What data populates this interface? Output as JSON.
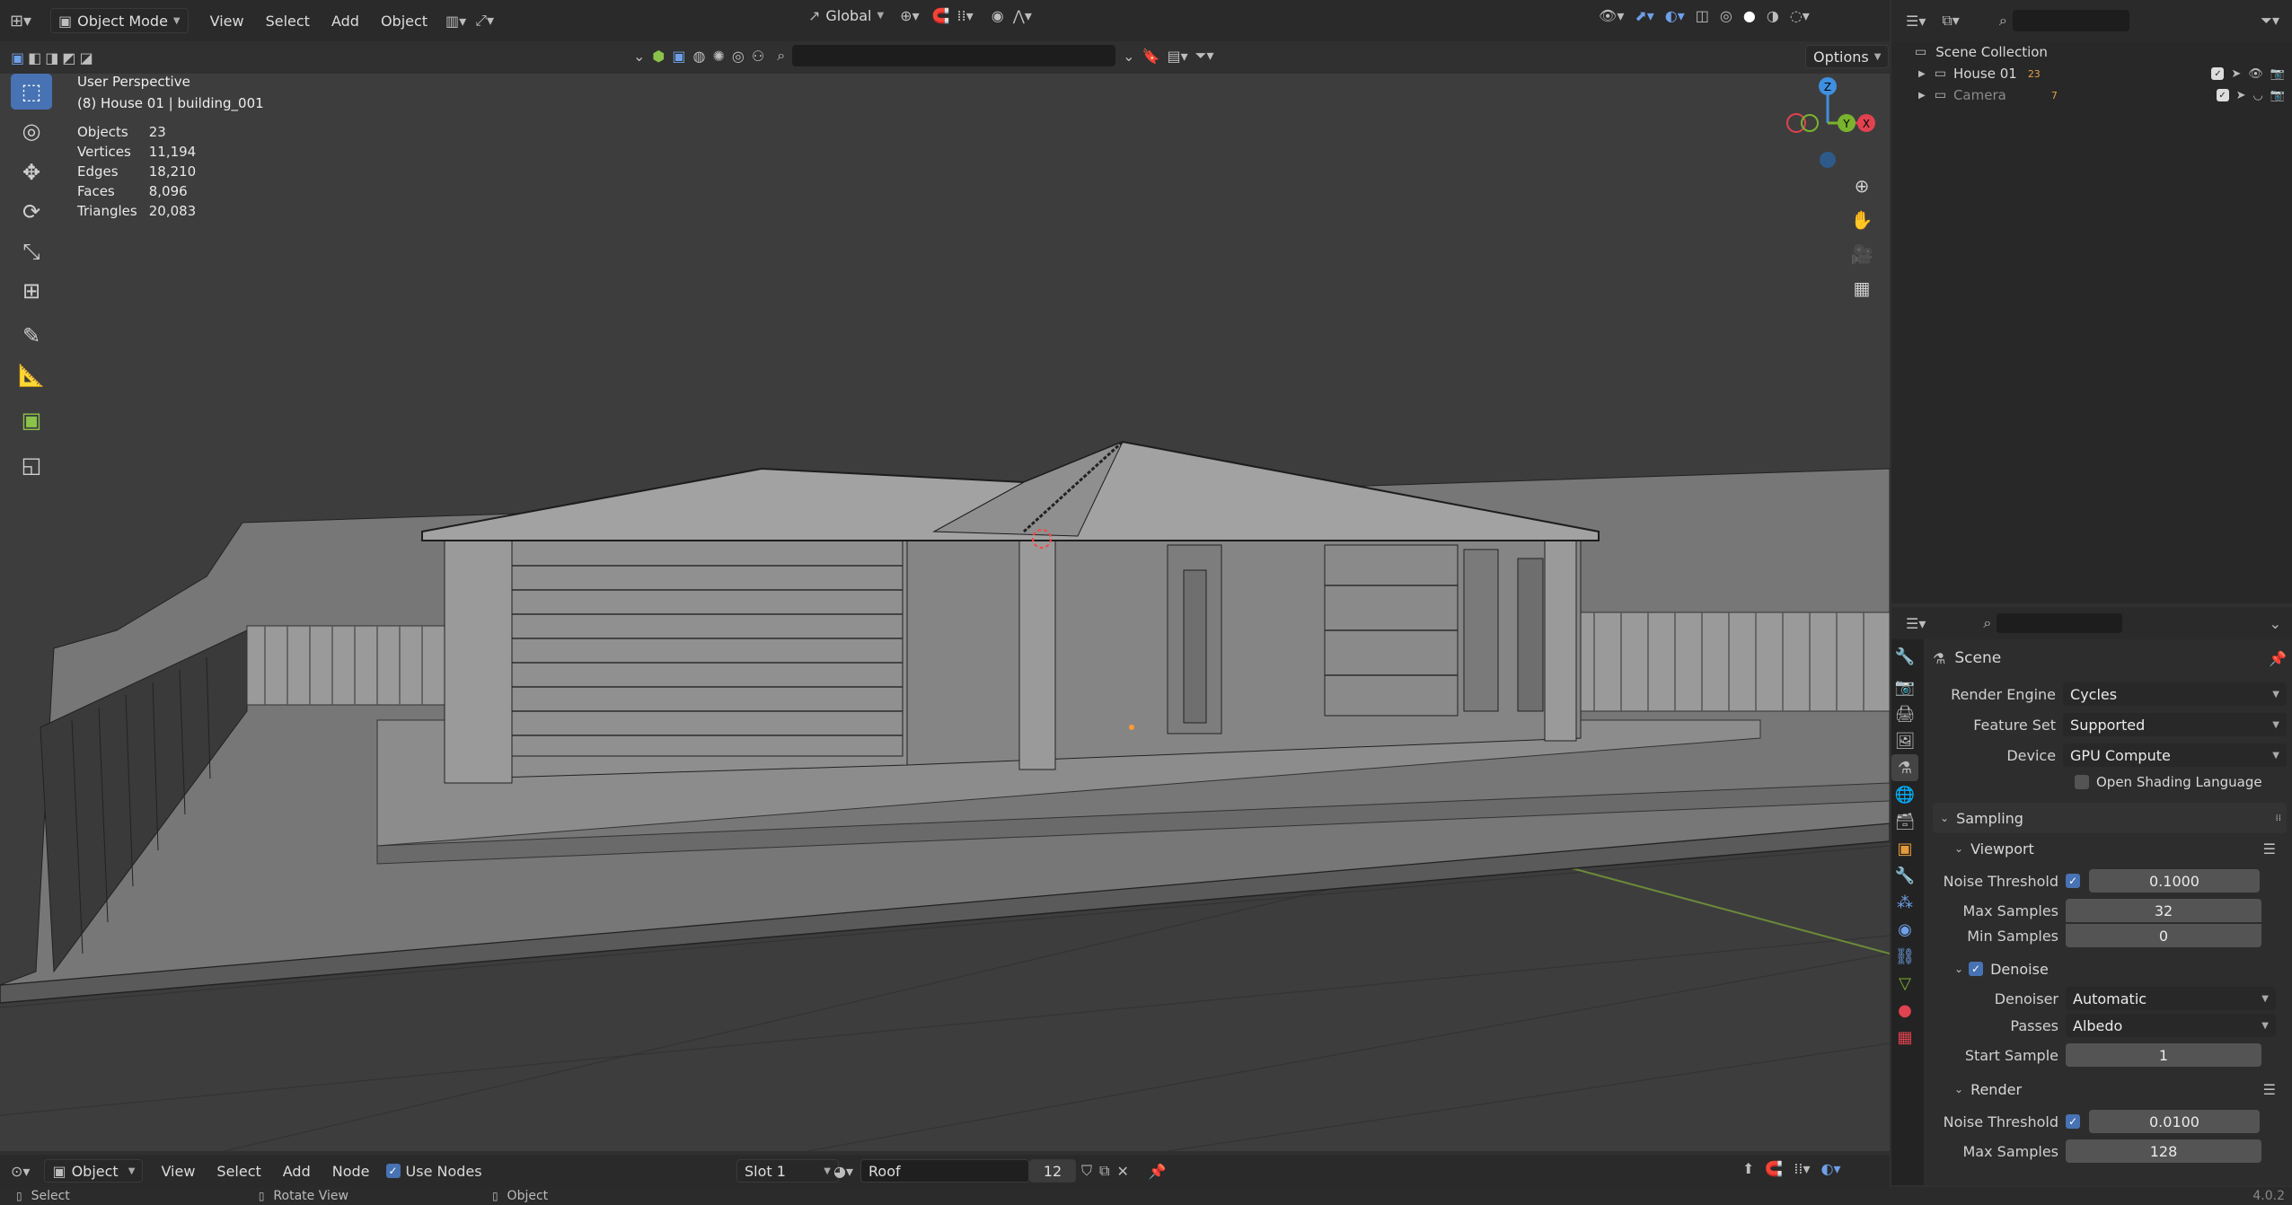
{
  "header": {
    "mode": "Object Mode",
    "menus": [
      "View",
      "Select",
      "Add",
      "Object"
    ],
    "orientation": "Global",
    "options": "Options"
  },
  "viewport": {
    "perspective": "User Perspective",
    "context": "(8) House 01 | building_001",
    "stats": [
      {
        "label": "Objects",
        "value": "23"
      },
      {
        "label": "Vertices",
        "value": "11,194"
      },
      {
        "label": "Edges",
        "value": "18,210"
      },
      {
        "label": "Faces",
        "value": "8,096"
      },
      {
        "label": "Triangles",
        "value": "20,083"
      }
    ],
    "axes": {
      "x": "X",
      "y": "Y",
      "z": "Z"
    }
  },
  "outliner": {
    "root": "Scene Collection",
    "items": [
      {
        "label": "House 01",
        "badge": "23"
      },
      {
        "label": "Camera",
        "badge": "7"
      }
    ]
  },
  "properties": {
    "title": "Scene",
    "render_engine_label": "Render Engine",
    "render_engine": "Cycles",
    "feature_set_label": "Feature Set",
    "feature_set": "Supported",
    "device_label": "Device",
    "device": "GPU Compute",
    "osl_label": "Open Shading Language",
    "sampling": "Sampling",
    "viewport_section": "Viewport",
    "noise_threshold_label": "Noise Threshold",
    "viewport_noise_threshold": "0.1000",
    "max_samples_label": "Max Samples",
    "viewport_max_samples": "32",
    "min_samples_label": "Min Samples",
    "viewport_min_samples": "0",
    "denoise_label": "Denoise",
    "denoiser_label": "Denoiser",
    "denoiser": "Automatic",
    "passes_label": "Passes",
    "passes": "Albedo",
    "start_sample_label": "Start Sample",
    "start_sample": "1",
    "render_section": "Render",
    "render_noise_threshold": "0.0100",
    "render_max_samples": "128"
  },
  "footer_bar": {
    "editor": "Object",
    "menus": [
      "View",
      "Select",
      "Add",
      "Node"
    ],
    "use_nodes": "Use Nodes",
    "slot": "Slot 1",
    "material": "Roof",
    "users": "12"
  },
  "status_bar": {
    "select": "Select",
    "rotate": "Rotate View",
    "object": "Object",
    "version": "4.0.2"
  },
  "colors": {
    "accent": "#4772b3",
    "axis_x": "#e0424f",
    "axis_y": "#7ab32e",
    "axis_z": "#3f8fe0"
  }
}
